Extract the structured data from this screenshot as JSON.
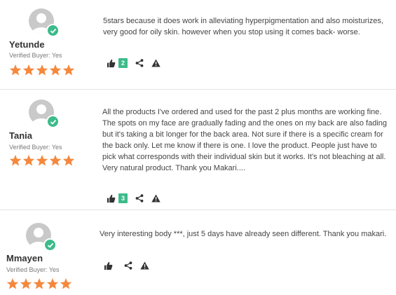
{
  "reviews": [
    {
      "author": "Yetunde",
      "verified": "Verified Buyer: Yes",
      "rating": 5,
      "text": "5stars because it does work in alleviating hyperpigmentation and also moisturizes,  very good for oily skin. however when you stop using it comes back- worse.",
      "helpful_count": "2"
    },
    {
      "author": "Tania",
      "verified": "Verified Buyer: Yes",
      "rating": 5,
      "text": "All the products I've ordered and used for the past 2 plus months are working fine. The spots on my face are gradually fading and the ones on my back are also fading but it's taking a bit longer for the back area. Not sure if there is a specific cream for the back only. Let me know if there is one. I love the product. People just have to pick what corresponds with their individual skin but it works. It's not bleaching at all. Very natural product. Thank you Makari....",
      "helpful_count": "3"
    },
    {
      "author": "Mmayen",
      "verified": "Verified Buyer: Yes",
      "rating": 5,
      "text": "Very interesting body ***, just 5 days have already seen different.  Thank you makari.",
      "helpful_count": ""
    }
  ],
  "colors": {
    "star": "#f5883d",
    "badge": "#3dbb8a",
    "avatar": "#c9c9c9",
    "icon": "#333333"
  },
  "icons": [
    "user-avatar-icon",
    "verified-check-icon",
    "star-icon",
    "thumbs-up-icon",
    "share-icon",
    "report-flag-icon"
  ]
}
